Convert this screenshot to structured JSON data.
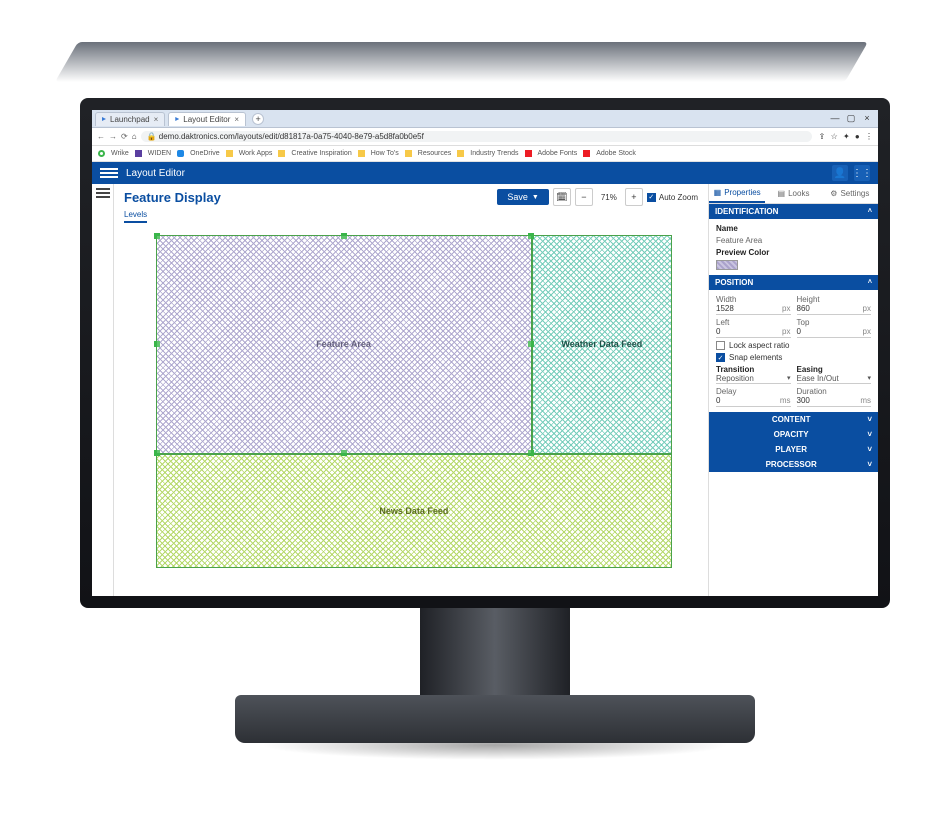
{
  "browser": {
    "tabs": [
      {
        "label": "Launchpad",
        "active": false
      },
      {
        "label": "Layout Editor",
        "active": true
      }
    ],
    "url": "demo.daktronics.com/layouts/edit/d81817a-0a75-4040-8e79-a5d8fa0b0e5f",
    "bookmarks": [
      "Wrike",
      "WIDEN",
      "OneDrive",
      "Work Apps",
      "Creative Inspiration",
      "How To's",
      "Resources",
      "Industry Trends",
      "Adobe Fonts",
      "Adobe Stock"
    ]
  },
  "appbar": {
    "title": "Layout Editor"
  },
  "editor": {
    "title": "Feature Display",
    "subtab": "Levels",
    "save_label": "Save",
    "zoom_pct": "71%",
    "autozoom_label": "Auto Zoom",
    "regions": {
      "feature": "Feature Area",
      "weather": "Weather Data Feed",
      "news": "News Data Feed"
    }
  },
  "panel": {
    "tabs": {
      "properties": "Properties",
      "looks": "Looks",
      "settings": "Settings"
    },
    "identification": {
      "title": "IDENTIFICATION",
      "name_label": "Name",
      "name_value": "Feature Area",
      "preview_label": "Preview Color"
    },
    "position": {
      "title": "POSITION",
      "width_label": "Width",
      "width_value": "1528",
      "width_unit": "px",
      "height_label": "Height",
      "height_value": "860",
      "height_unit": "px",
      "left_label": "Left",
      "left_value": "0",
      "left_unit": "px",
      "top_label": "Top",
      "top_value": "0",
      "top_unit": "px",
      "lock_label": "Lock aspect ratio",
      "snap_label": "Snap elements",
      "transition_label": "Transition",
      "transition_value": "Reposition",
      "easing_label": "Easing",
      "easing_value": "Ease In/Out",
      "delay_label": "Delay",
      "delay_value": "0",
      "delay_unit": "ms",
      "duration_label": "Duration",
      "duration_value": "300",
      "duration_unit": "ms"
    },
    "collapsed": [
      "CONTENT",
      "OPACITY",
      "PLAYER",
      "PROCESSOR"
    ]
  }
}
